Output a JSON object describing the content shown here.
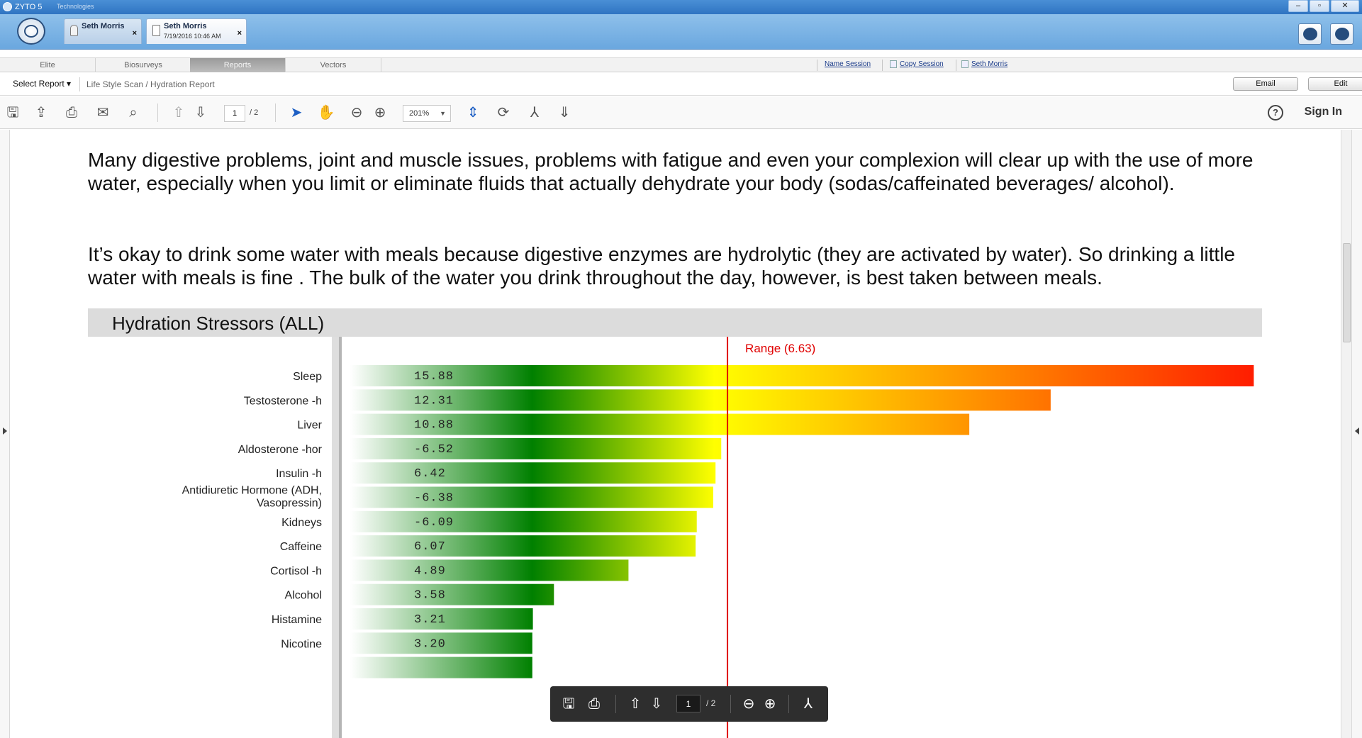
{
  "window": {
    "title": "ZYTO 5",
    "subtitle": "Technologies",
    "minimize": "–",
    "maximize": "▫",
    "close": "✕"
  },
  "sessions": [
    {
      "name": "Seth Morris",
      "date": "",
      "close": "×"
    },
    {
      "name": "Seth Morris",
      "date": "7/19/2016  10:46 AM",
      "close": "×"
    }
  ],
  "nav": {
    "tabs": [
      "Elite",
      "Biosurveys",
      "Reports",
      "Vectors"
    ],
    "active_tab": "Reports",
    "links": [
      "Name Session",
      "Copy Session",
      "Seth Morris"
    ]
  },
  "breadcrumb": {
    "select_report": "Select Report ▾",
    "path": "Life Style Scan / Hydration Report",
    "email_label": "Email",
    "edit_label": "Edit"
  },
  "toolbar": {
    "page_current": "1",
    "page_total": "/ 2",
    "zoom": "201%",
    "help": "?",
    "sign_in": "Sign In"
  },
  "document": {
    "paragraph1": "Many digestive problems, joint and muscle issues, problems with fatigue and even your complexion will clear up with the use of more water, especially when you limit or eliminate fluids that actually dehydrate your body (sodas/caffeinated beverages/ alcohol).",
    "paragraph2": "It’s okay to drink some water with meals because digestive enzymes are hydrolytic (they are activated by water). So drinking a little water with meals is fine . The bulk of the water you drink throughout the day, however, is best taken between meals."
  },
  "chart_data": {
    "type": "bar",
    "orientation": "horizontal",
    "title": "Hydration Stressors (ALL)",
    "threshold": {
      "label": "Range (6.63)",
      "value": 6.63,
      "color": "#e00000"
    },
    "categories": [
      "Sleep",
      "Testosterone -h",
      "Liver",
      "Aldosterone -hor",
      "Insulin -h",
      "Antidiuretic Hormone (ADH, Vasopressin)",
      "Kidneys",
      "Caffeine",
      "Cortisol -h",
      "Alcohol",
      "Histamine",
      "Nicotine"
    ],
    "values": [
      15.88,
      12.31,
      10.88,
      -6.52,
      6.42,
      -6.38,
      -6.09,
      6.07,
      4.89,
      3.58,
      3.21,
      3.2
    ],
    "labels": [
      "15.88",
      "12.31",
      "10.88",
      "-6.52",
      "6.42",
      "-6.38",
      "-6.09",
      "6.07",
      "4.89",
      "3.58",
      "3.21",
      "3.20"
    ],
    "xlim": [
      0,
      16
    ],
    "colors": {
      "low": "#ffffff",
      "mid": "#008000",
      "threshold": "#ffff00",
      "high": "#ff1a00"
    }
  },
  "floating_bar": {
    "page_current": "1",
    "page_total": "/ 2"
  }
}
